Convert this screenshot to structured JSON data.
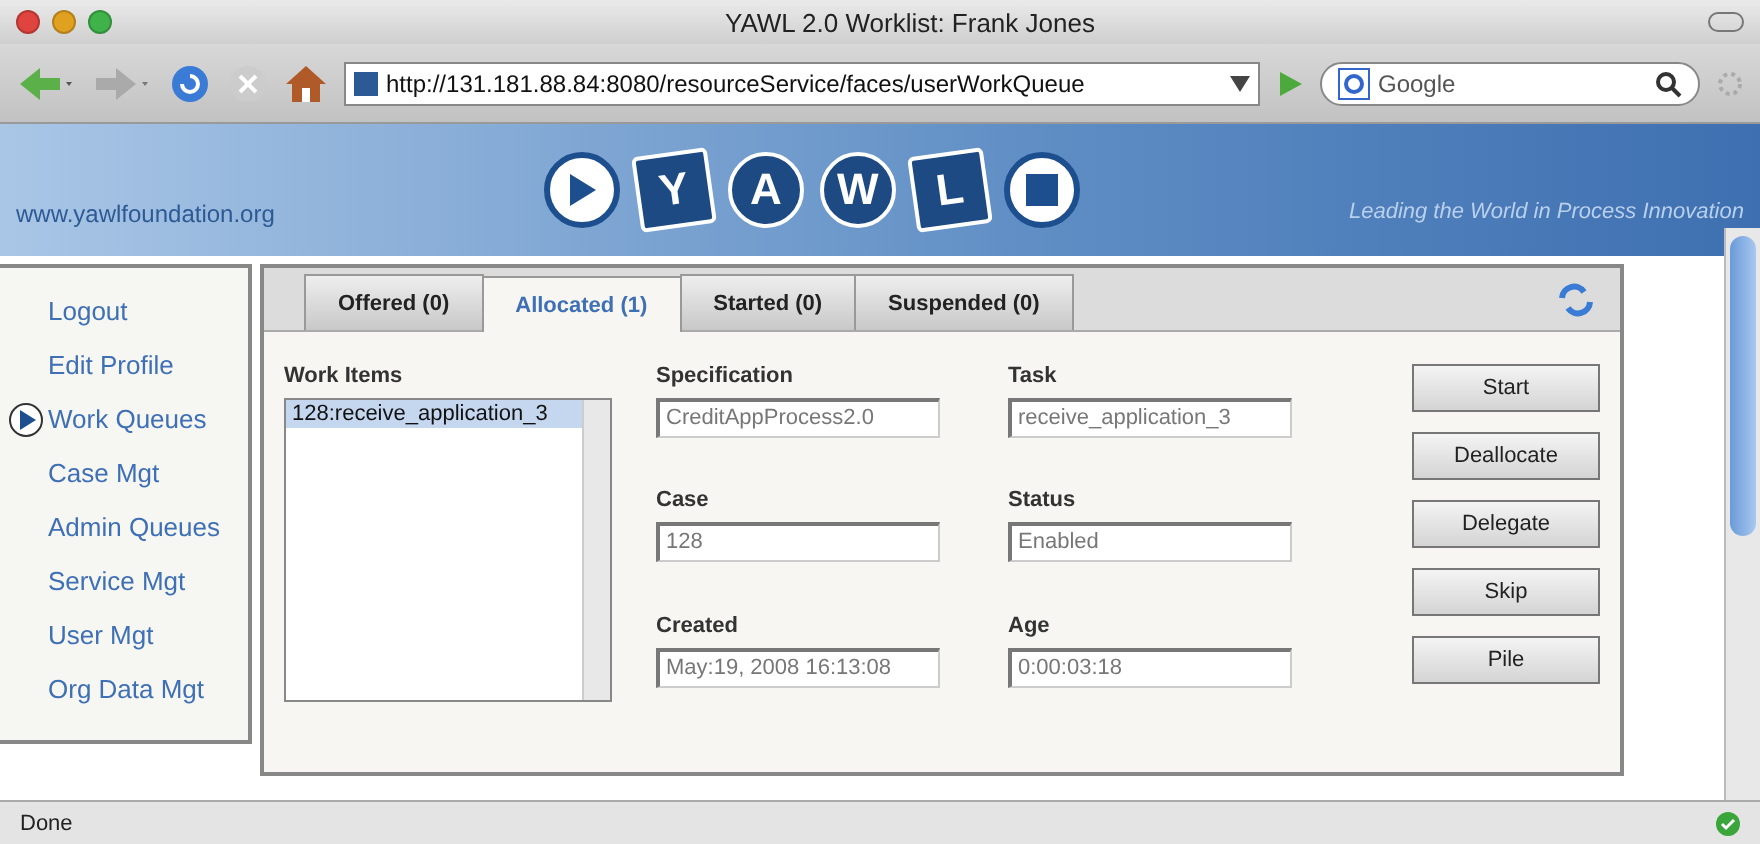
{
  "window": {
    "title": "YAWL 2.0 Worklist: Frank Jones"
  },
  "toolbar": {
    "url": "http://131.181.88.84:8080/resourceService/faces/userWorkQueue",
    "search_placeholder": "Google"
  },
  "banner": {
    "site": "www.yawlfoundation.org",
    "logo_letters": [
      "Y",
      "A",
      "W",
      "L"
    ],
    "tagline": "Leading the World in Process Innovation"
  },
  "sidebar": {
    "items": [
      {
        "label": "Logout",
        "selected": false
      },
      {
        "label": "Edit Profile",
        "selected": false
      },
      {
        "label": "Work Queues",
        "selected": true
      },
      {
        "label": "Case Mgt",
        "selected": false
      },
      {
        "label": "Admin Queues",
        "selected": false
      },
      {
        "label": "Service Mgt",
        "selected": false
      },
      {
        "label": "User Mgt",
        "selected": false
      },
      {
        "label": "Org Data Mgt",
        "selected": false
      }
    ]
  },
  "tabs": [
    {
      "label": "Offered (0)",
      "selected": false
    },
    {
      "label": "Allocated (1)",
      "selected": true
    },
    {
      "label": "Started (0)",
      "selected": false
    },
    {
      "label": "Suspended (0)",
      "selected": false
    }
  ],
  "work_items": {
    "label": "Work Items",
    "items": [
      {
        "label": "128:receive_application_3",
        "selected": true
      }
    ]
  },
  "fields": [
    {
      "label": "Specification",
      "value": "CreditAppProcess2.0"
    },
    {
      "label": "Task",
      "value": "receive_application_3"
    },
    {
      "label": "Case",
      "value": "128"
    },
    {
      "label": "Status",
      "value": "Enabled"
    },
    {
      "label": "Created",
      "value": "May:19, 2008 16:13:08"
    },
    {
      "label": "Age",
      "value": "0:00:03:18"
    }
  ],
  "buttons": [
    "Start",
    "Deallocate",
    "Delegate",
    "Skip",
    "Pile"
  ],
  "status_bar": "Done"
}
